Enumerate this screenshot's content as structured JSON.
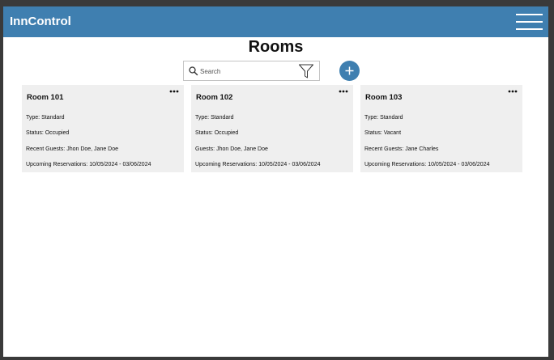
{
  "app": {
    "title": "InnControl"
  },
  "page": {
    "title": "Rooms"
  },
  "search": {
    "placeholder": "Search",
    "value": ""
  },
  "colors": {
    "accent": "#3f7fb0",
    "card_bg": "#efefef",
    "text": "#111111"
  },
  "icons": {
    "menu": "hamburger-menu-icon",
    "search": "magnifier-icon",
    "filter": "funnel-icon",
    "add": "plus-icon",
    "more": "ellipsis-icon"
  },
  "rooms": [
    {
      "title": "Room 101",
      "type": "Type: Standard",
      "status": "Status: Occupied",
      "guests": "Recent Guests: Jhon Doe, Jane Doe",
      "reservations": "Upcoming Reservations: 10/05/2024 - 03/06/2024"
    },
    {
      "title": "Room 102",
      "type": "Type: Standard",
      "status": "Status: Occupied",
      "guests": "Guests: Jhon Doe, Jane Doe",
      "reservations": "Upcoming Reservations: 10/05/2024 - 03/06/2024"
    },
    {
      "title": "Room 103",
      "type": "Type: Standard",
      "status": "Status: Vacant",
      "guests": "Recent Guests: Jane Charles",
      "reservations": "Upcoming Reservations: 10/05/2024 - 03/06/2024"
    }
  ]
}
